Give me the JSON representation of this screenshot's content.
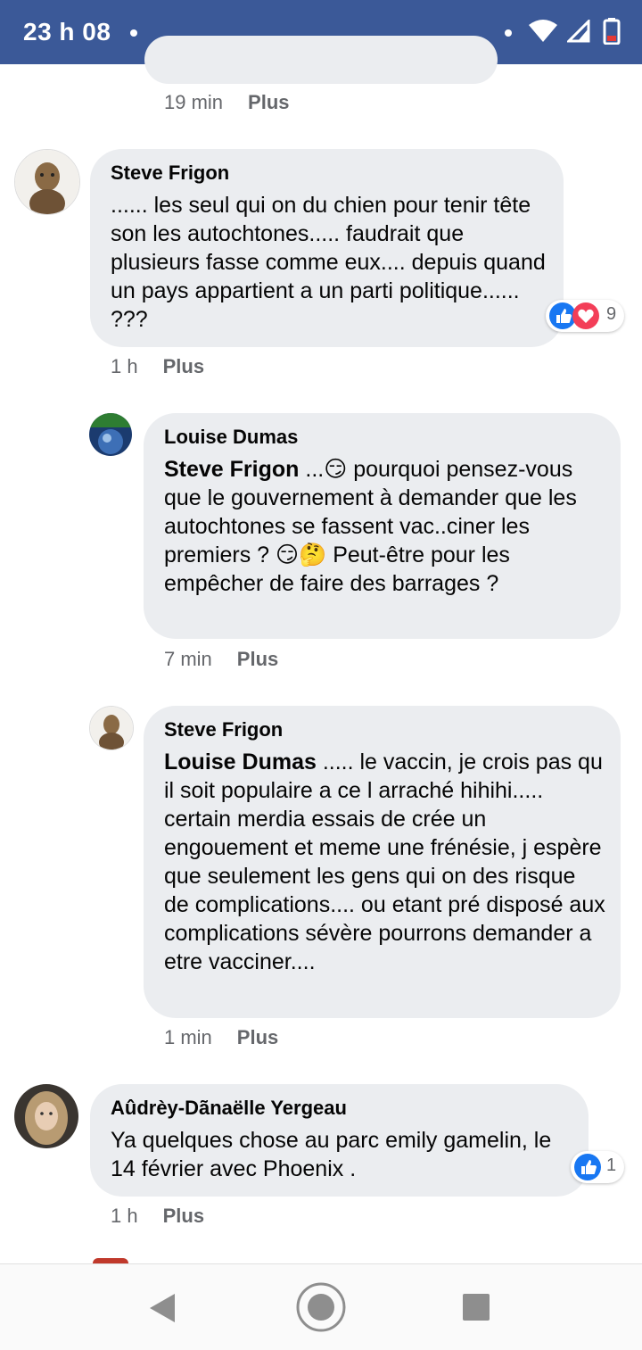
{
  "status_bar": {
    "time": "23 h 08"
  },
  "top_comment": {
    "time": "19 min",
    "action": "Plus"
  },
  "comments": [
    {
      "author": "Steve Frigon",
      "text": "...... les seul qui on du chien pour tenir tête son les autochtones..... faudrait que plusieurs fasse comme eux.... depuis quand un pays appartient a un parti politique...... ???",
      "reactions": {
        "icons": [
          "like-icon",
          "love-icon"
        ],
        "count": "9"
      },
      "time": "1 h",
      "action": "Plus"
    },
    {
      "author": "Louise Dumas",
      "mention": "Steve Frigon",
      "text_a": " ...",
      "emoji_a": "😏",
      "text_b": " pourquoi pensez-vous que le gouvernement à demander que les autochtones se fassent vac..ciner les premiers ? ",
      "emoji_b": "😏🤔",
      "text_c": " Peut-être pour les empêcher de faire des barrages ?",
      "time": "7 min",
      "action": "Plus"
    },
    {
      "author": "Steve Frigon",
      "mention": "Louise Dumas",
      "text": " ..... le vaccin, je crois pas qu il soit populaire a ce l arraché hihihi..... certain merdia essais de crée un engouement et meme une frénésie, j espère que seulement les gens qui on des risque de complications.... ou etant pré disposé aux complications sévère pourrons demander a etre vacciner....",
      "time": "1 min",
      "action": "Plus"
    },
    {
      "author": "Aûdrèy-Dãnaëlle Yergeau",
      "text": "Ya quelques chose au parc emily gamelin, le 14 février avec Phoenix .",
      "reactions": {
        "icons": [
          "like-icon"
        ],
        "count": "1"
      },
      "time": "1 h",
      "action": "Plus"
    }
  ],
  "colors": {
    "status_bar": "#3b5998",
    "bubble": "#ebedf0",
    "like": "#1877f2",
    "love": "#f33e58",
    "meta": "#65676b"
  }
}
